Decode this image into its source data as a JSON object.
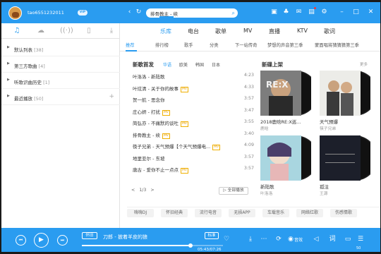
{
  "titlebar": {
    "username": "tao6551232011",
    "vip_badge": "VIP",
    "search_value": "排骨教主 - 续",
    "icons": [
      "back-icon",
      "refresh-icon",
      "search-icon",
      "music-box-icon",
      "shirt-icon",
      "mail-icon",
      "gift-icon",
      "settings-icon",
      "minimize-icon",
      "close-icon"
    ]
  },
  "sidebar": {
    "tabs": [
      "music-note-icon",
      "cloud-icon",
      "radio-icon",
      "device-icon",
      "download-icon"
    ],
    "items": [
      {
        "label": "默认列表",
        "count": "[38]"
      },
      {
        "label": "第三方歌曲",
        "count": "[4]"
      },
      {
        "label": "听歌识曲历史",
        "count": "[1]"
      },
      {
        "label": "最近播放",
        "count": "[50]"
      }
    ]
  },
  "nav": {
    "items": [
      "乐库",
      "电台",
      "歌单",
      "MV",
      "直播",
      "KTV",
      "歌词"
    ],
    "active": "乐库"
  },
  "subnav": {
    "items": [
      "推荐",
      "排行榜",
      "歌手",
      "分类",
      "下一站传奇",
      "梦想的声音第三季",
      "蒙面唱将猜猜猜第三季"
    ],
    "active": "推荐"
  },
  "new_songs": {
    "title": "新歌首发",
    "tabs": [
      "华语",
      "欧美",
      "韩国",
      "日本"
    ],
    "active_tab": "华语",
    "songs": [
      {
        "name": "叶洛洛 - 新陆歌",
        "badge": "",
        "duration": "4:23"
      },
      {
        "name": "叶炫清 - 关于你的故事",
        "badge": "MV",
        "duration": "4:33"
      },
      {
        "name": "贺一航 - 思念你",
        "badge": "",
        "duration": "3:57"
      },
      {
        "name": "庄心妍 - 打扰",
        "badge": "MV",
        "duration": "3:47"
      },
      {
        "name": "简弘亦 - 不痛默的谈吐",
        "badge": "MV",
        "duration": "3:55"
      },
      {
        "name": "排骨教主 - 续",
        "badge": "MV",
        "duration": "3:40"
      },
      {
        "name": "筷子兄弟 - 天气预爆【个天气预爆电...",
        "badge": "MV",
        "duration": "4:09"
      },
      {
        "name": "地里亚尔 - 东坡",
        "badge": "",
        "duration": "3:57"
      },
      {
        "name": "唐古 - 爱你不止一点点",
        "badge": "MV",
        "duration": "3:57"
      }
    ],
    "pager": {
      "prev": "<",
      "page": "1/3",
      "next": ">"
    },
    "play_all": "全部播放"
  },
  "new_albums": {
    "title": "新碟上架",
    "more": "更多",
    "albums": [
      {
        "name": "2018鹿晗RE:X巡...",
        "artist": "鹿晗",
        "sleeve_color": "#8f8f8f"
      },
      {
        "name": "天气预爆",
        "artist": "筷子兄弟",
        "sleeve_color": "#e7e7e2"
      },
      {
        "name": "新陆歌",
        "artist": "叶洛洛",
        "sleeve_color": "#9fd0dc"
      },
      {
        "name": "孤注",
        "artist": "王源",
        "sleeve_color": "#1c1f2a"
      }
    ]
  },
  "tags": [
    "嗨嗨DJ",
    "怀旧经典",
    "流行电音",
    "无损APP",
    "车载音乐",
    "网络红歌",
    "伤感情歌"
  ],
  "player": {
    "mode": "怀旧",
    "title": "刀郎 - 披着羊皮的狼",
    "quality": "标准",
    "time": "05:43/07:26",
    "progress": 0.77,
    "download_label": "音效",
    "playlist_count": "50"
  },
  "colors": {
    "accent": "#2a9cf0",
    "badge": "#e8a100"
  }
}
